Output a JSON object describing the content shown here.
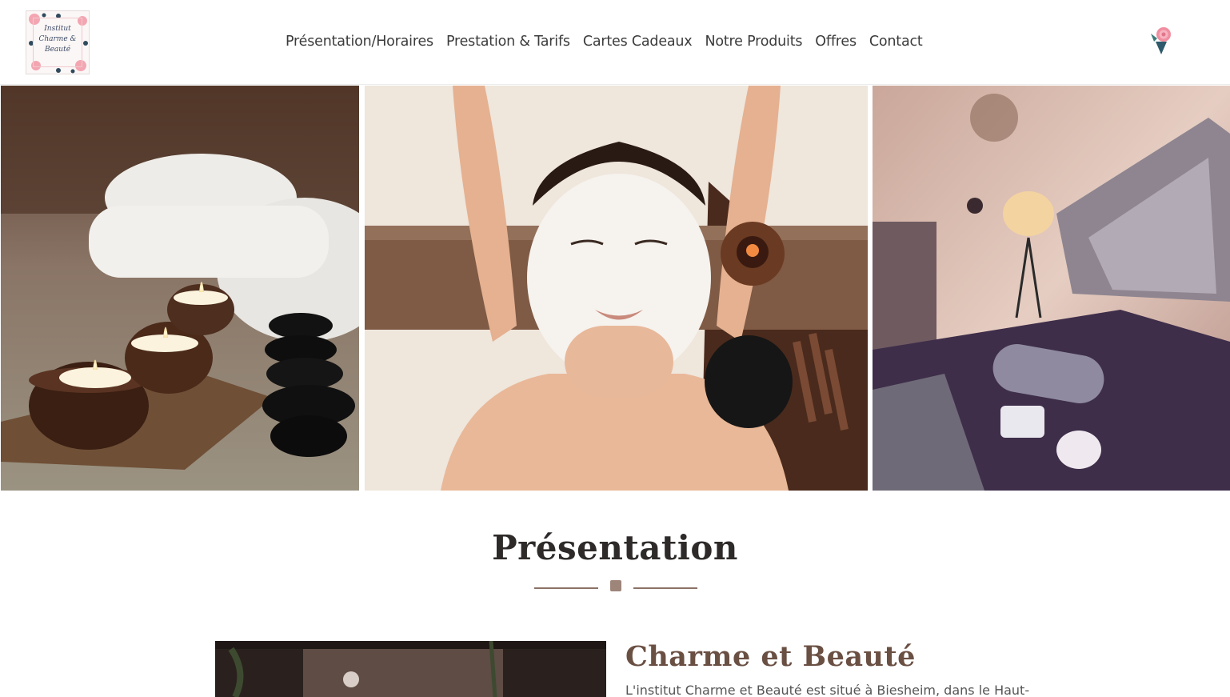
{
  "header": {
    "logo_text": [
      "Institut",
      "Charme &",
      "Beauté"
    ],
    "nav": [
      {
        "label": "Présentation/Horaires"
      },
      {
        "label": "Prestation & Tarifs"
      },
      {
        "label": "Cartes Cadeaux"
      },
      {
        "label": "Notre Produits"
      },
      {
        "label": "Offres"
      },
      {
        "label": "Contact"
      }
    ],
    "right_icon": "rose-icon"
  },
  "hero": {
    "images": [
      "candles-and-stones-photo",
      "facial-mask-massage-photo",
      "massage-room-photo"
    ]
  },
  "presentation": {
    "title": "Présentation",
    "about_title": "Charme et Beauté",
    "about_text": "L'institut Charme et Beauté est situé à Biesheim, dans le Haut-"
  },
  "colors": {
    "accent": "#8c7266",
    "title_brown": "#6a4f43",
    "nav_text": "#3b3b3b"
  }
}
